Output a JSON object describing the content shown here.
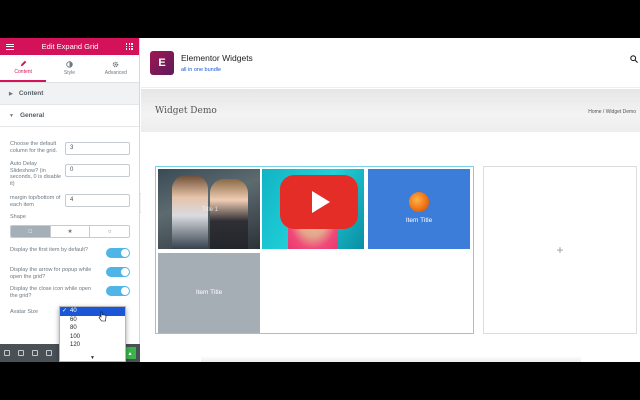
{
  "panel": {
    "title": "Edit Expand Grid",
    "tabs": [
      {
        "label": "Content"
      },
      {
        "label": "Style"
      },
      {
        "label": "Advanced"
      }
    ],
    "sections": {
      "content": "Content",
      "general": "General"
    },
    "controls": {
      "columns_label": "Choose the default column for the grid.",
      "columns_value": "3",
      "delay_label": "Auto Delay Slideshow? (in seconds, 0 is disable it)",
      "delay_value": "0",
      "margin_label": "margin top/bottom of each item",
      "margin_value": "4",
      "shape_label": "Shape",
      "shape_options": [
        "square",
        "star",
        "circle"
      ],
      "first_item_label": "Display the first item by default?",
      "arrow_label": "Display the arrow for popup while open the grid?",
      "close_icon_label": "Display the close icon while open the grid?",
      "avatar_label": "Avatar Size"
    },
    "avatar_dropdown": {
      "selected": "40",
      "options": [
        "40",
        "60",
        "80",
        "100",
        "120"
      ]
    }
  },
  "site": {
    "name": "Elementor Widgets",
    "tagline": "all in one bundle",
    "logo_letter": "E",
    "page_title": "Widget Demo",
    "breadcrumbs": "Home  /  Widget Demo"
  },
  "grid": {
    "item1_caption": "Title 1",
    "item3_title": "Item Title",
    "item4_title": "Item Title"
  },
  "add_symbol": "+",
  "colors": {
    "brand": "#d3125a",
    "toggle_on": "#4fb5e6",
    "item_blue": "#3b7dd8",
    "item_gray": "#a5adb5",
    "youtube": "#e52d27"
  }
}
